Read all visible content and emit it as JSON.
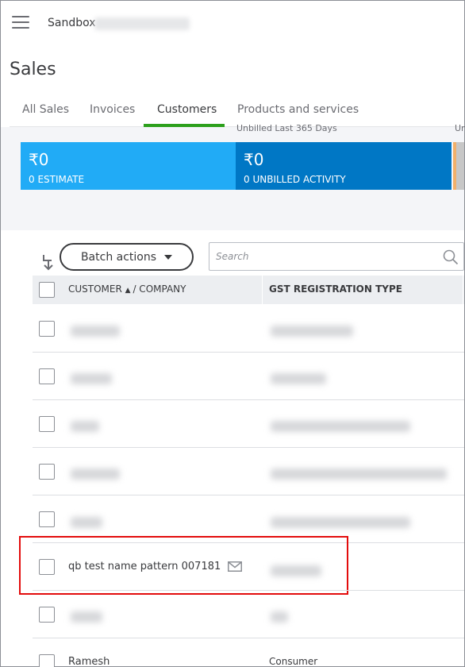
{
  "header": {
    "menu_icon": "hamburger-menu-icon",
    "company_label": "Sandbox",
    "page_title": "Sales"
  },
  "tabs": [
    {
      "label": "All Sales",
      "active": false
    },
    {
      "label": "Invoices",
      "active": false
    },
    {
      "label": "Customers",
      "active": true
    },
    {
      "label": "Products and services",
      "active": false
    }
  ],
  "stats": {
    "caption_main": "Unbilled Last 365 Days",
    "caption_edge": "Un",
    "boxes": [
      {
        "amount": "₹0",
        "label": "0 ESTIMATE",
        "color": "#21abf6"
      },
      {
        "amount": "₹0",
        "label": "0 UNBILLED ACTIVITY",
        "color": "#0077c5"
      }
    ]
  },
  "toolbar": {
    "batch_actions_label": "Batch actions",
    "search_placeholder": "Search"
  },
  "table": {
    "columns": [
      "CUSTOMER",
      "/ COMPANY",
      "GST REGISTRATION TYPE"
    ],
    "rows": [
      {
        "customer": "",
        "gst_type": "",
        "blurred": true
      },
      {
        "customer": "",
        "gst_type": "",
        "blurred": true
      },
      {
        "customer": "",
        "gst_type": "",
        "blurred": true
      },
      {
        "customer": "",
        "gst_type": "",
        "blurred": true
      },
      {
        "customer": "",
        "gst_type": "",
        "blurred": true
      },
      {
        "customer": "qb test name pattern 007181",
        "gst_type": "",
        "blurred": false,
        "highlighted": true
      },
      {
        "customer": "",
        "gst_type": "",
        "blurred": true
      },
      {
        "customer": "Ramesh",
        "gst_type": "Consumer",
        "blurred": false
      }
    ]
  },
  "colors": {
    "active_tab_accent": "#2ca01c",
    "highlight_border": "#e30c0c"
  }
}
